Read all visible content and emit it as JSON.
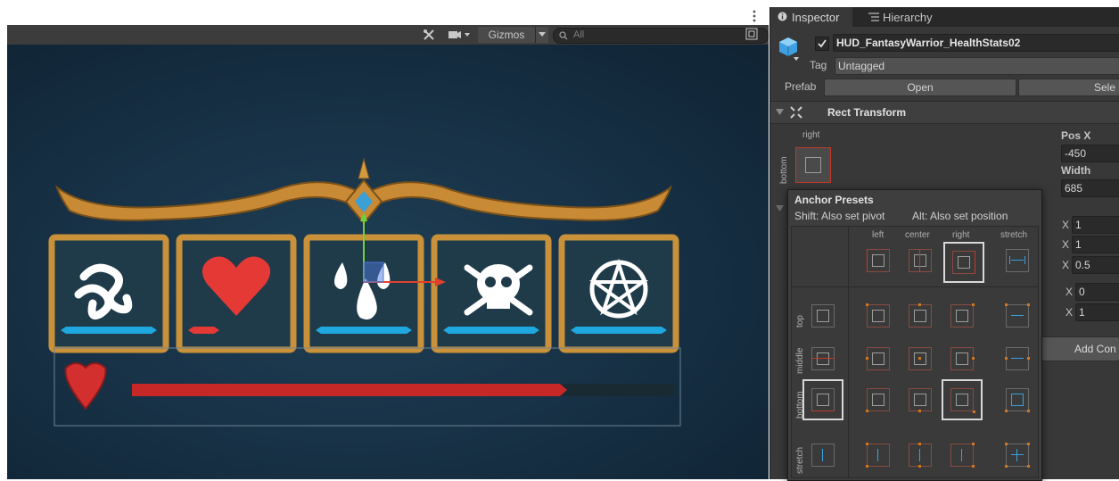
{
  "scene": {
    "toolbar": {
      "tools_icon": "crossed-tools-icon",
      "camera_icon": "camera-icon",
      "gizmos_label": "Gizmos",
      "search_placeholder": "All"
    },
    "hud": {
      "slots": [
        "serpent-icon",
        "heart-icon",
        "drops-icon",
        "skull-crossbones-icon",
        "pentagram-icon"
      ],
      "colors": {
        "frame_gold": "#c9913a",
        "bar_blue": "#1fa8e0",
        "bar_red": "#c62828",
        "slot_bg": "#1f3b4a"
      }
    }
  },
  "inspector": {
    "tabs": {
      "inspector": "Inspector",
      "hierarchy": "Hierarchy"
    },
    "object_name": "HUD_FantasyWarrior_HealthStats02",
    "tag_label": "Tag",
    "tag_value": "Untagged",
    "prefab_label": "Prefab",
    "prefab_open": "Open",
    "prefab_select": "Sele",
    "rect_transform_title": "Rect Transform",
    "anchor_horizontal": "right",
    "anchor_vertical": "bottom",
    "pos_x_label": "Pos X",
    "pos_x_value": "-450",
    "width_label": "Width",
    "width_value": "685",
    "x_rows": [
      {
        "label": "X",
        "value": "1"
      },
      {
        "label": "X",
        "value": "1"
      },
      {
        "label": "X",
        "value": "0.5"
      },
      {
        "label": "X",
        "value": "0"
      },
      {
        "label": "X",
        "value": "1"
      }
    ],
    "add_component": "Add Con"
  },
  "anchor_popup": {
    "title": "Anchor Presets",
    "hint_shift": "Shift: Also set pivot",
    "hint_alt": "Alt: Also set position",
    "col_labels": [
      "left",
      "center",
      "right",
      "stretch"
    ],
    "row_labels": [
      "top",
      "middle",
      "bottom",
      "stretch"
    ]
  }
}
